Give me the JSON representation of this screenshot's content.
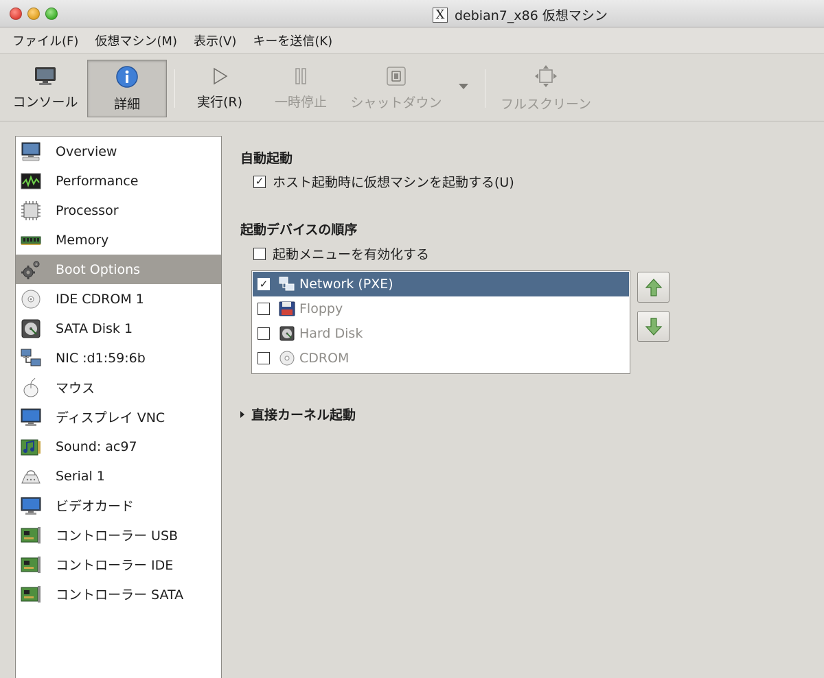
{
  "window": {
    "title": "debian7_x86 仮想マシン",
    "x_logo": "X"
  },
  "menubar": {
    "items": [
      "ファイル(F)",
      "仮想マシン(M)",
      "表示(V)",
      "キーを送信(K)"
    ]
  },
  "toolbar": {
    "console": "コンソール",
    "details": "詳細",
    "run": "実行(R)",
    "pause": "一時停止",
    "shutdown": "シャットダウン",
    "fullscreen": "フルスクリーン"
  },
  "sidebar": {
    "selected_index": 4,
    "items": [
      {
        "label": "Overview",
        "icon": "monitor-icon"
      },
      {
        "label": "Performance",
        "icon": "performance-graph-icon"
      },
      {
        "label": "Processor",
        "icon": "cpu-chip-icon"
      },
      {
        "label": "Memory",
        "icon": "memory-module-icon"
      },
      {
        "label": "Boot Options",
        "icon": "gears-icon"
      },
      {
        "label": "IDE CDROM 1",
        "icon": "cdrom-icon"
      },
      {
        "label": "SATA Disk 1",
        "icon": "hard-disk-icon"
      },
      {
        "label": "NIC :d1:59:6b",
        "icon": "network-icon"
      },
      {
        "label": "マウス",
        "icon": "mouse-icon"
      },
      {
        "label": "ディスプレイ VNC",
        "icon": "display-icon"
      },
      {
        "label": "Sound: ac97",
        "icon": "sound-card-icon"
      },
      {
        "label": "Serial 1",
        "icon": "serial-port-icon"
      },
      {
        "label": "ビデオカード",
        "icon": "video-card-icon"
      },
      {
        "label": "コントローラー USB",
        "icon": "controller-card-icon"
      },
      {
        "label": "コントローラー IDE",
        "icon": "controller-card-icon"
      },
      {
        "label": "コントローラー SATA",
        "icon": "controller-card-icon"
      }
    ]
  },
  "autostart": {
    "title": "自動起動",
    "checkbox_label": "ホスト起動時に仮想マシンを起動する(U)",
    "checked": true
  },
  "boot_order": {
    "title": "起動デバイスの順序",
    "menu_checkbox_label": "起動メニューを有効化する",
    "menu_checked": false,
    "devices": [
      {
        "label": "Network (PXE)",
        "checked": true,
        "icon": "network-icon"
      },
      {
        "label": "Floppy",
        "checked": false,
        "icon": "floppy-icon"
      },
      {
        "label": "Hard Disk",
        "checked": false,
        "icon": "hard-disk-icon"
      },
      {
        "label": "CDROM",
        "checked": false,
        "icon": "cdrom-icon"
      }
    ]
  },
  "direct_kernel": {
    "title": "直接カーネル起動",
    "expanded": false
  },
  "colors": {
    "selection_sidebar": "#a09d97",
    "selection_list": "#4e6b8c",
    "window_bg": "#dcdad5",
    "arrow_green": "#5f9a4e"
  }
}
